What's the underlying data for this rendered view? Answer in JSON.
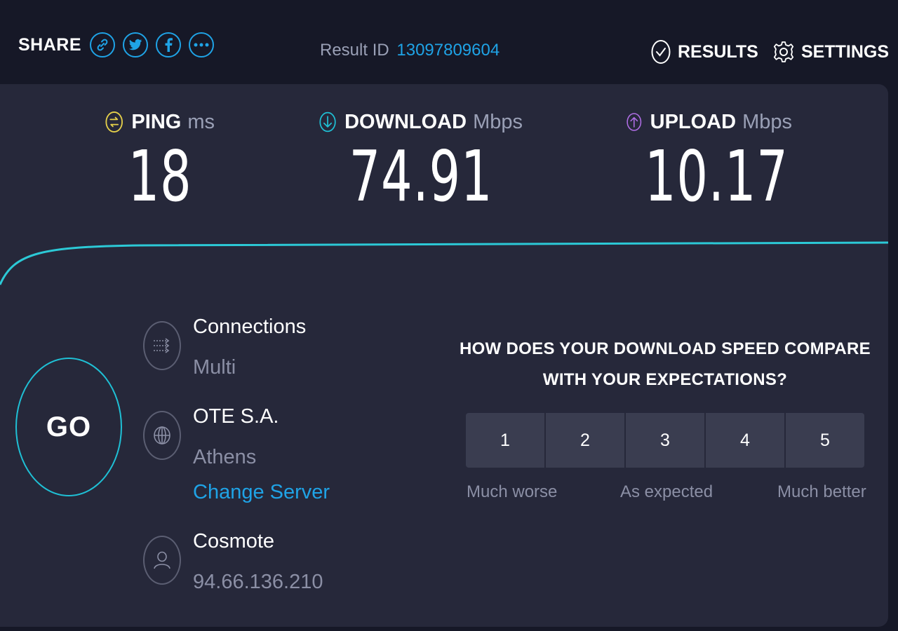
{
  "share": {
    "label": "SHARE"
  },
  "result": {
    "label": "Result ID",
    "id": "13097809604"
  },
  "nav": {
    "results": "RESULTS",
    "settings": "SETTINGS"
  },
  "metrics": {
    "ping": {
      "label": "PING",
      "unit": "ms",
      "value": "18",
      "color": "#e6d14a"
    },
    "download": {
      "label": "DOWNLOAD",
      "unit": "Mbps",
      "value": "74.91",
      "color": "#1fc0d5"
    },
    "upload": {
      "label": "UPLOAD",
      "unit": "Mbps",
      "value": "10.17",
      "color": "#b06ee6"
    }
  },
  "go": {
    "label": "GO"
  },
  "connections": {
    "title": "Connections",
    "value": "Multi"
  },
  "server": {
    "title": "OTE S.A.",
    "location": "Athens",
    "change_link": "Change Server"
  },
  "isp": {
    "title": "Cosmote",
    "ip": "94.66.136.210"
  },
  "survey": {
    "question_line1": "HOW DOES YOUR DOWNLOAD SPEED COMPARE",
    "question_line2": "WITH YOUR EXPECTATIONS?",
    "options": [
      "1",
      "2",
      "3",
      "4",
      "5"
    ],
    "low_label": "Much worse",
    "mid_label": "As expected",
    "high_label": "Much better"
  },
  "colors": {
    "accent": "#1fa3e6",
    "background": "#161827",
    "panel": "#26283a"
  }
}
